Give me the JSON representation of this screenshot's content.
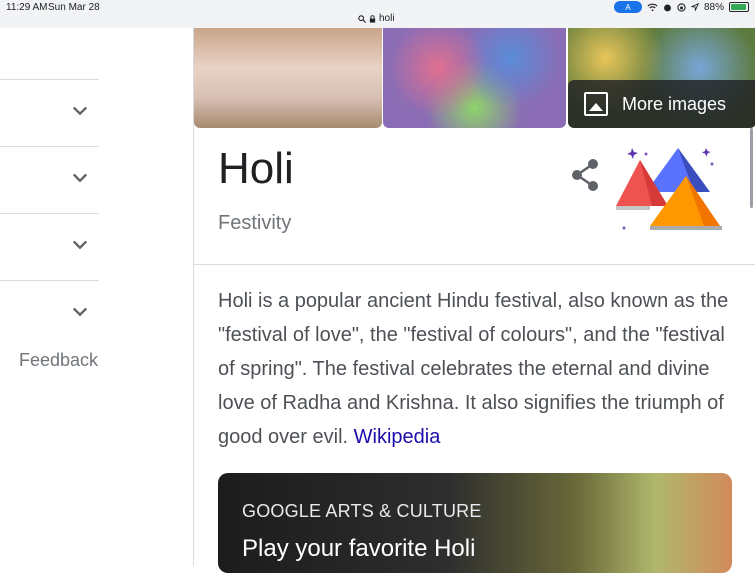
{
  "status": {
    "time": "11:29 AM",
    "date": "Sun Mar 28",
    "url": "holi",
    "battery": "88%"
  },
  "sidebar": {
    "feedback": "Feedback",
    "rows": 4
  },
  "panel": {
    "more_images": "More images",
    "title": "Holi",
    "subtitle": "Festivity",
    "description": "Holi is a popular ancient Hindu festival, also known as the \"festival of love\", the \"festival of colours\", and the \"festival of spring\". The festival celebrates the eternal and divine love of Radha and Krishna. It also signifies the triumph of good over evil. ",
    "source_link": "Wikipedia",
    "card": {
      "kicker": "GOOGLE ARTS & CULTURE",
      "headline": "Play your favorite Holi"
    }
  },
  "colors": {
    "link": "#1a0dab",
    "secondary_text": "#70757a",
    "divider": "#dadce0"
  }
}
